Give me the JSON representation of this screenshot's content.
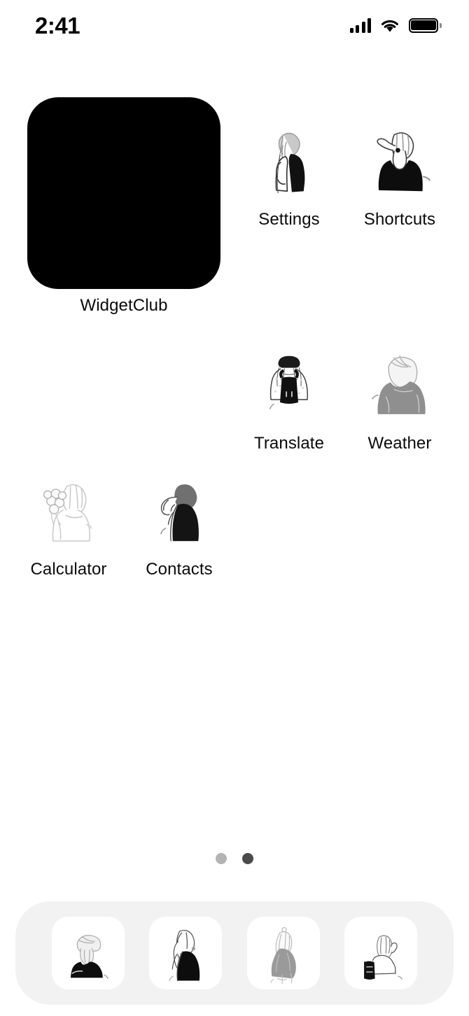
{
  "status_bar": {
    "time": "2:41",
    "cellular_icon": "cellular-signal-icon",
    "cellular_bars": 4,
    "wifi_icon": "wifi-icon",
    "battery_icon": "battery-full-icon",
    "battery_level": "full"
  },
  "home_screen": {
    "background_color": "#ffffff",
    "widget": {
      "label": "WidgetClub",
      "color": "#000000",
      "size": "medium"
    },
    "apps": [
      {
        "label": "Settings",
        "icon": "settings-app-icon",
        "art": "person-with-backpack-line-art"
      },
      {
        "label": "Shortcuts",
        "icon": "shortcuts-app-icon",
        "art": "person-with-hat-black-top-line-art"
      },
      {
        "label": "Translate",
        "icon": "translate-app-icon",
        "art": "person-beret-overalls-line-art"
      },
      {
        "label": "Weather",
        "icon": "weather-app-icon",
        "art": "person-gray-sweater-back-view-line-art"
      },
      {
        "label": "Calculator",
        "icon": "calculator-app-icon",
        "art": "person-holding-flowers-line-art"
      },
      {
        "label": "Contacts",
        "icon": "contacts-app-icon",
        "art": "person-dark-dress-line-art"
      }
    ],
    "page_dots": {
      "count": 2,
      "active_index": 1,
      "inactive_color": "#b4b4b4",
      "active_color": "#4a4a4a"
    },
    "dock": {
      "background_color": "#f2f2f2",
      "tile_color": "#ffffff",
      "apps": [
        {
          "icon": "dock-app-1-icon",
          "art": "person-sitting-gray-hair-black-skirt-line-art"
        },
        {
          "icon": "dock-app-2-icon",
          "art": "person-long-hair-black-dress-line-art"
        },
        {
          "icon": "dock-app-3-icon",
          "art": "person-back-view-gray-coat-line-art"
        },
        {
          "icon": "dock-app-4-icon",
          "art": "person-seated-with-black-backpack-line-art"
        }
      ]
    }
  }
}
